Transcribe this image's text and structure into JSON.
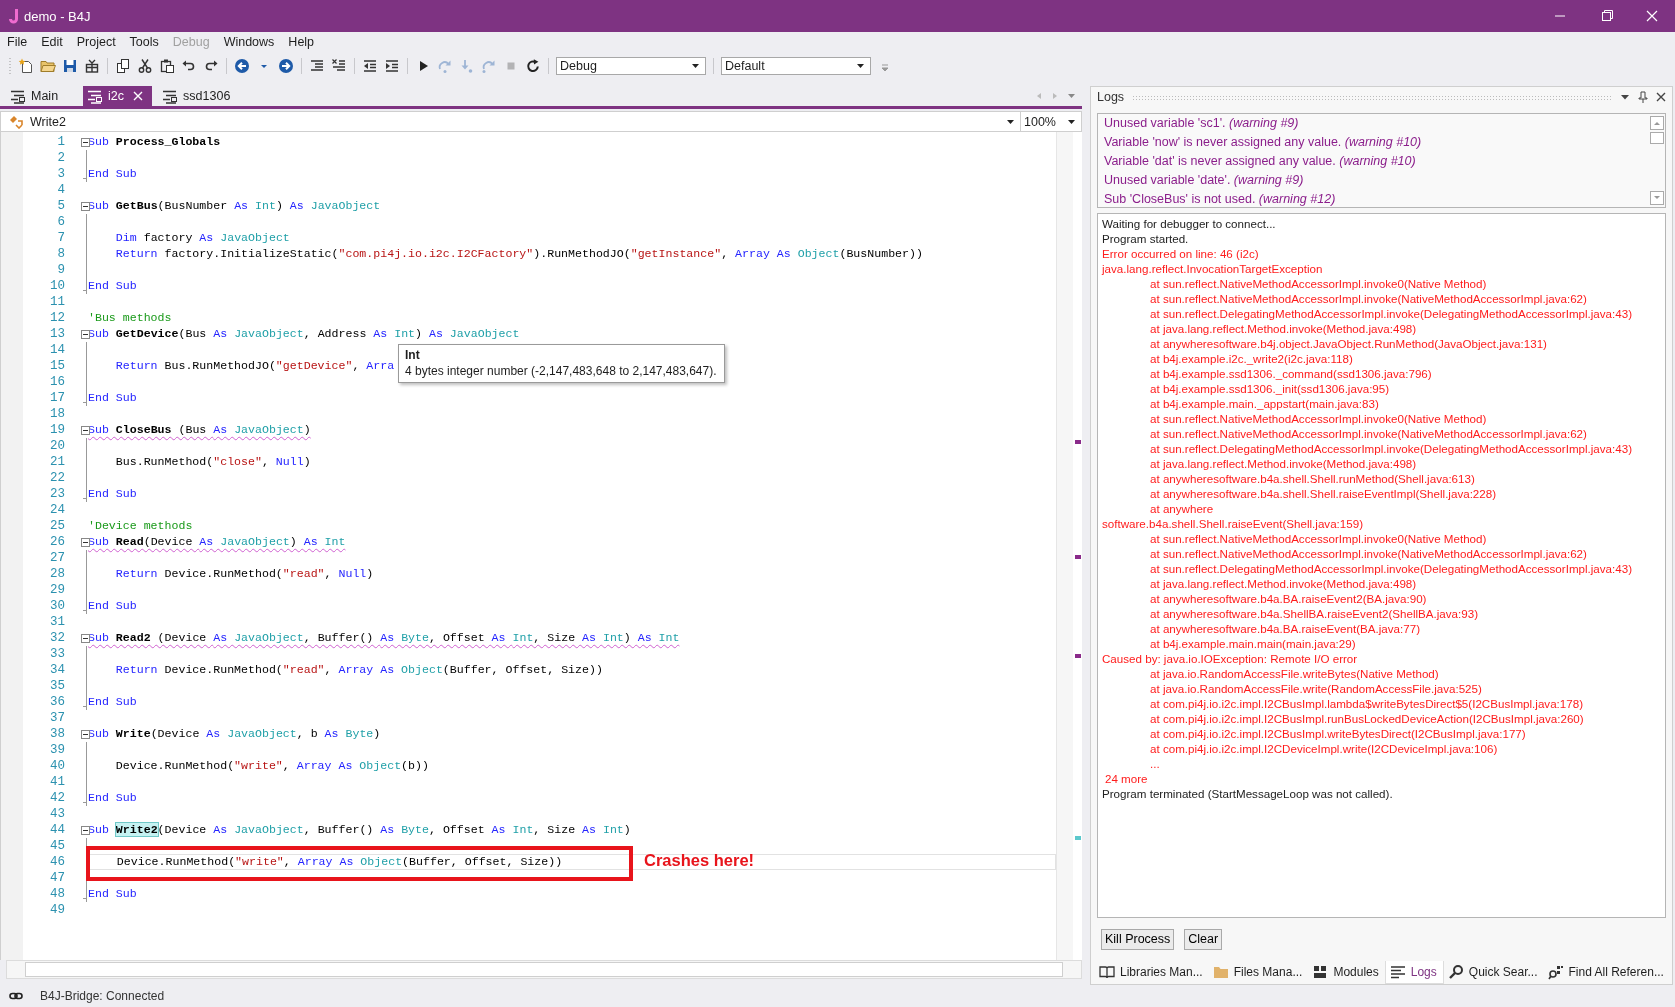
{
  "window": {
    "title": "demo - B4J"
  },
  "menu": [
    {
      "label": "File",
      "disabled": false
    },
    {
      "label": "Edit",
      "disabled": false
    },
    {
      "label": "Project",
      "disabled": false
    },
    {
      "label": "Tools",
      "disabled": false
    },
    {
      "label": "Debug",
      "disabled": true
    },
    {
      "label": "Windows",
      "disabled": false
    },
    {
      "label": "Help",
      "disabled": false
    }
  ],
  "toolbar": {
    "buttons": [
      {
        "kind": "new",
        "disabled": false
      },
      {
        "kind": "open",
        "disabled": false
      },
      {
        "kind": "save",
        "disabled": false
      },
      {
        "kind": "package",
        "disabled": false
      },
      {
        "kind": "separator"
      },
      {
        "kind": "copy",
        "disabled": false
      },
      {
        "kind": "cut",
        "disabled": false
      },
      {
        "kind": "paste",
        "disabled": false
      },
      {
        "kind": "undo",
        "disabled": false
      },
      {
        "kind": "redo",
        "disabled": false
      },
      {
        "kind": "separator"
      },
      {
        "kind": "back",
        "disabled": false
      },
      {
        "kind": "history",
        "disabled": false
      },
      {
        "kind": "forward",
        "disabled": false
      },
      {
        "kind": "separator"
      },
      {
        "kind": "comment",
        "disabled": false
      },
      {
        "kind": "uncomment",
        "disabled": false
      },
      {
        "kind": "separator"
      },
      {
        "kind": "outdent",
        "disabled": false
      },
      {
        "kind": "indent",
        "disabled": false
      },
      {
        "kind": "separator"
      },
      {
        "kind": "run",
        "disabled": false
      },
      {
        "kind": "step_over",
        "disabled": true
      },
      {
        "kind": "step_in",
        "disabled": true
      },
      {
        "kind": "step_out",
        "disabled": true
      },
      {
        "kind": "stop",
        "disabled": true
      },
      {
        "kind": "restart",
        "disabled": false
      }
    ],
    "build_config": "Debug",
    "platform": "Default"
  },
  "editor": {
    "tabs": [
      {
        "label": "Main",
        "selected": false,
        "closable": false
      },
      {
        "label": "i2c",
        "selected": true,
        "closable": true
      },
      {
        "label": "ssd1306",
        "selected": false,
        "closable": false
      }
    ],
    "method": "Write2",
    "zoom": "100%",
    "lines": [
      {
        "number": "1",
        "kind": "sub",
        "warning": false,
        "current": false,
        "tokens": [
          {
            "kind": "keyword",
            "text": "Sub "
          },
          {
            "kind": "name",
            "text": "Process_Globals"
          }
        ]
      },
      {
        "number": "2",
        "kind": "plain",
        "warning": false,
        "current": false
      },
      {
        "number": "3",
        "kind": "end",
        "warning": false,
        "current": false,
        "tokens": [
          {
            "kind": "keyword",
            "text": "End Sub"
          }
        ]
      },
      {
        "number": "4",
        "kind": "plain",
        "warning": false,
        "current": false
      },
      {
        "number": "5",
        "kind": "sub",
        "warning": false,
        "current": false,
        "tokens": [
          {
            "kind": "keyword",
            "text": "Sub "
          },
          {
            "kind": "name",
            "text": "GetBus"
          },
          {
            "kind": "plain",
            "text": "(BusNumber "
          },
          {
            "kind": "keyword",
            "text": "As "
          },
          {
            "kind": "type",
            "text": "Int"
          },
          {
            "kind": "plain",
            "text": ") "
          },
          {
            "kind": "keyword",
            "text": "As "
          },
          {
            "kind": "type",
            "text": "JavaObject"
          }
        ]
      },
      {
        "number": "6",
        "kind": "plain",
        "warning": false,
        "current": false
      },
      {
        "number": "7",
        "kind": "plain",
        "warning": false,
        "current": false,
        "tokens": [
          {
            "kind": "keyword",
            "text": "    Dim "
          },
          {
            "kind": "plain",
            "text": "factory "
          },
          {
            "kind": "keyword",
            "text": "As "
          },
          {
            "kind": "type",
            "text": "JavaObject"
          }
        ]
      },
      {
        "number": "8",
        "kind": "plain",
        "warning": false,
        "current": false,
        "tokens": [
          {
            "kind": "keyword",
            "text": "    Return "
          },
          {
            "kind": "plain",
            "text": "factory.InitializeStatic("
          },
          {
            "kind": "string",
            "text": "\"com.pi4j.io.i2c.I2CFactory\""
          },
          {
            "kind": "plain",
            "text": ").RunMethodJO("
          },
          {
            "kind": "string",
            "text": "\"getInstance\""
          },
          {
            "kind": "plain",
            "text": ", "
          },
          {
            "kind": "keyword",
            "text": "Array As "
          },
          {
            "kind": "type",
            "text": "Object"
          },
          {
            "kind": "plain",
            "text": "(BusNumber))"
          }
        ]
      },
      {
        "number": "9",
        "kind": "plain",
        "warning": false,
        "current": false
      },
      {
        "number": "10",
        "kind": "end",
        "warning": false,
        "current": false,
        "tokens": [
          {
            "kind": "keyword",
            "text": "End Sub"
          }
        ]
      },
      {
        "number": "11",
        "kind": "plain",
        "warning": false,
        "current": false
      },
      {
        "number": "12",
        "kind": "plain",
        "warning": false,
        "current": false,
        "tokens": [
          {
            "kind": "comment",
            "text": "'Bus methods"
          }
        ]
      },
      {
        "number": "13",
        "kind": "sub",
        "warning": false,
        "current": false,
        "tokens": [
          {
            "kind": "keyword",
            "text": "Sub "
          },
          {
            "kind": "name",
            "text": "GetDevice"
          },
          {
            "kind": "plain",
            "text": "(Bus "
          },
          {
            "kind": "keyword",
            "text": "As "
          },
          {
            "kind": "type",
            "text": "JavaObject"
          },
          {
            "kind": "plain",
            "text": ", Address "
          },
          {
            "kind": "keyword",
            "text": "As "
          },
          {
            "kind": "type",
            "text": "Int"
          },
          {
            "kind": "plain",
            "text": ") "
          },
          {
            "kind": "keyword",
            "text": "As "
          },
          {
            "kind": "type",
            "text": "JavaObject"
          }
        ]
      },
      {
        "number": "14",
        "kind": "plain",
        "warning": false,
        "current": false
      },
      {
        "number": "15",
        "kind": "plain",
        "warning": false,
        "current": false,
        "tokens": [
          {
            "kind": "keyword",
            "text": "    Return "
          },
          {
            "kind": "plain",
            "text": "Bus.RunMethodJO("
          },
          {
            "kind": "string",
            "text": "\"getDevice\""
          },
          {
            "kind": "plain",
            "text": ", "
          },
          {
            "kind": "keyword",
            "text": "Arra"
          }
        ]
      },
      {
        "number": "16",
        "kind": "plain",
        "warning": false,
        "current": false
      },
      {
        "number": "17",
        "kind": "end",
        "warning": false,
        "current": false,
        "tokens": [
          {
            "kind": "keyword",
            "text": "End Sub"
          }
        ]
      },
      {
        "number": "18",
        "kind": "plain",
        "warning": false,
        "current": false
      },
      {
        "number": "19",
        "kind": "sub",
        "warning": true,
        "current": false,
        "tokens": [
          {
            "kind": "keyword",
            "text": "Sub "
          },
          {
            "kind": "name",
            "text": "CloseBus"
          },
          {
            "kind": "plain",
            "text": " (Bus "
          },
          {
            "kind": "keyword",
            "text": "As "
          },
          {
            "kind": "type",
            "text": "JavaObject"
          },
          {
            "kind": "plain",
            "text": ")"
          }
        ]
      },
      {
        "number": "20",
        "kind": "plain",
        "warning": false,
        "current": false
      },
      {
        "number": "21",
        "kind": "plain",
        "warning": false,
        "current": false,
        "tokens": [
          {
            "kind": "plain",
            "text": "    Bus.RunMethod("
          },
          {
            "kind": "string",
            "text": "\"close\""
          },
          {
            "kind": "plain",
            "text": ", "
          },
          {
            "kind": "keyword",
            "text": "Null"
          },
          {
            "kind": "plain",
            "text": ")"
          }
        ]
      },
      {
        "number": "22",
        "kind": "plain",
        "warning": false,
        "current": false
      },
      {
        "number": "23",
        "kind": "end",
        "warning": false,
        "current": false,
        "tokens": [
          {
            "kind": "keyword",
            "text": "End Sub"
          }
        ]
      },
      {
        "number": "24",
        "kind": "plain",
        "warning": false,
        "current": false
      },
      {
        "number": "25",
        "kind": "plain",
        "warning": false,
        "current": false,
        "tokens": [
          {
            "kind": "comment",
            "text": "'Device methods"
          }
        ]
      },
      {
        "number": "26",
        "kind": "sub",
        "warning": true,
        "current": false,
        "tokens": [
          {
            "kind": "keyword",
            "text": "Sub "
          },
          {
            "kind": "name",
            "text": "Read"
          },
          {
            "kind": "plain",
            "text": "(Device "
          },
          {
            "kind": "keyword",
            "text": "As "
          },
          {
            "kind": "type",
            "text": "JavaObject"
          },
          {
            "kind": "plain",
            "text": ") "
          },
          {
            "kind": "keyword",
            "text": "As "
          },
          {
            "kind": "type",
            "text": "Int"
          }
        ]
      },
      {
        "number": "27",
        "kind": "plain",
        "warning": false,
        "current": false
      },
      {
        "number": "28",
        "kind": "plain",
        "warning": false,
        "current": false,
        "tokens": [
          {
            "kind": "keyword",
            "text": "    Return "
          },
          {
            "kind": "plain",
            "text": "Device.RunMethod("
          },
          {
            "kind": "string",
            "text": "\"read\""
          },
          {
            "kind": "plain",
            "text": ", "
          },
          {
            "kind": "keyword",
            "text": "Null"
          },
          {
            "kind": "plain",
            "text": ")"
          }
        ]
      },
      {
        "number": "29",
        "kind": "plain",
        "warning": false,
        "current": false
      },
      {
        "number": "30",
        "kind": "end",
        "warning": false,
        "current": false,
        "tokens": [
          {
            "kind": "keyword",
            "text": "End Sub"
          }
        ]
      },
      {
        "number": "31",
        "kind": "plain",
        "warning": false,
        "current": false
      },
      {
        "number": "32",
        "kind": "sub",
        "warning": true,
        "current": false,
        "tokens": [
          {
            "kind": "keyword",
            "text": "Sub "
          },
          {
            "kind": "name",
            "text": "Read2"
          },
          {
            "kind": "plain",
            "text": " (Device "
          },
          {
            "kind": "keyword",
            "text": "As "
          },
          {
            "kind": "type",
            "text": "JavaObject"
          },
          {
            "kind": "plain",
            "text": ", Buffer() "
          },
          {
            "kind": "keyword",
            "text": "As "
          },
          {
            "kind": "type",
            "text": "Byte"
          },
          {
            "kind": "plain",
            "text": ", Offset "
          },
          {
            "kind": "keyword",
            "text": "As "
          },
          {
            "kind": "type",
            "text": "Int"
          },
          {
            "kind": "plain",
            "text": ", Size "
          },
          {
            "kind": "keyword",
            "text": "As "
          },
          {
            "kind": "type",
            "text": "Int"
          },
          {
            "kind": "plain",
            "text": ") "
          },
          {
            "kind": "keyword",
            "text": "As "
          },
          {
            "kind": "type",
            "text": "Int"
          }
        ]
      },
      {
        "number": "33",
        "kind": "plain",
        "warning": false,
        "current": false
      },
      {
        "number": "34",
        "kind": "plain",
        "warning": false,
        "current": false,
        "tokens": [
          {
            "kind": "keyword",
            "text": "    Return "
          },
          {
            "kind": "plain",
            "text": "Device.RunMethod("
          },
          {
            "kind": "string",
            "text": "\"read\""
          },
          {
            "kind": "plain",
            "text": ", "
          },
          {
            "kind": "keyword",
            "text": "Array As "
          },
          {
            "kind": "type",
            "text": "Object"
          },
          {
            "kind": "plain",
            "text": "(Buffer, Offset, Size))"
          }
        ]
      },
      {
        "number": "35",
        "kind": "plain",
        "warning": false,
        "current": false
      },
      {
        "number": "36",
        "kind": "end",
        "warning": false,
        "current": false,
        "tokens": [
          {
            "kind": "keyword",
            "text": "End Sub"
          }
        ]
      },
      {
        "number": "37",
        "kind": "plain",
        "warning": false,
        "current": false
      },
      {
        "number": "38",
        "kind": "sub",
        "warning": false,
        "current": false,
        "tokens": [
          {
            "kind": "keyword",
            "text": "Sub "
          },
          {
            "kind": "name",
            "text": "Write"
          },
          {
            "kind": "plain",
            "text": "(Device "
          },
          {
            "kind": "keyword",
            "text": "As "
          },
          {
            "kind": "type",
            "text": "JavaObject"
          },
          {
            "kind": "plain",
            "text": ", b "
          },
          {
            "kind": "keyword",
            "text": "As "
          },
          {
            "kind": "type",
            "text": "Byte"
          },
          {
            "kind": "plain",
            "text": ")"
          }
        ]
      },
      {
        "number": "39",
        "kind": "plain",
        "warning": false,
        "current": false
      },
      {
        "number": "40",
        "kind": "plain",
        "warning": false,
        "current": false,
        "tokens": [
          {
            "kind": "plain",
            "text": "    Device.RunMethod("
          },
          {
            "kind": "string",
            "text": "\"write\""
          },
          {
            "kind": "plain",
            "text": ", "
          },
          {
            "kind": "keyword",
            "text": "Array As "
          },
          {
            "kind": "type",
            "text": "Object"
          },
          {
            "kind": "plain",
            "text": "(b))"
          }
        ]
      },
      {
        "number": "41",
        "kind": "plain",
        "warning": false,
        "current": false
      },
      {
        "number": "42",
        "kind": "end",
        "warning": false,
        "current": false,
        "tokens": [
          {
            "kind": "keyword",
            "text": "End Sub"
          }
        ]
      },
      {
        "number": "43",
        "kind": "plain",
        "warning": false,
        "current": false
      },
      {
        "number": "44",
        "kind": "sub",
        "warning": false,
        "current": false,
        "tokens": [
          {
            "kind": "keyword",
            "text": "Sub "
          },
          {
            "kind": "match",
            "text": "Write2"
          },
          {
            "kind": "plain",
            "text": "(Device "
          },
          {
            "kind": "keyword",
            "text": "As "
          },
          {
            "kind": "type",
            "text": "JavaObject"
          },
          {
            "kind": "plain",
            "text": ", Buffer() "
          },
          {
            "kind": "keyword",
            "text": "As "
          },
          {
            "kind": "type",
            "text": "Byte"
          },
          {
            "kind": "plain",
            "text": ", Offset "
          },
          {
            "kind": "keyword",
            "text": "As "
          },
          {
            "kind": "type",
            "text": "Int"
          },
          {
            "kind": "plain",
            "text": ", Size "
          },
          {
            "kind": "keyword",
            "text": "As "
          },
          {
            "kind": "type",
            "text": "Int"
          },
          {
            "kind": "plain",
            "text": ")"
          }
        ]
      },
      {
        "number": "45",
        "kind": "plain",
        "warning": false,
        "current": false
      },
      {
        "number": "46",
        "kind": "plain",
        "warning": false,
        "current": true,
        "tokens": [
          {
            "kind": "plain",
            "text": "    Device.RunMethod("
          },
          {
            "kind": "string",
            "text": "\"write\""
          },
          {
            "kind": "plain",
            "text": ", "
          },
          {
            "kind": "keyword",
            "text": "Array As "
          },
          {
            "kind": "type",
            "text": "Object"
          },
          {
            "kind": "plain",
            "text": "(Buffer, Offset, Size))"
          }
        ]
      },
      {
        "number": "47",
        "kind": "plain",
        "warning": false,
        "current": false
      },
      {
        "number": "48",
        "kind": "end",
        "warning": false,
        "current": false,
        "tokens": [
          {
            "kind": "keyword",
            "text": "End Sub"
          }
        ]
      },
      {
        "number": "49",
        "kind": "plain",
        "warning": false,
        "current": false
      }
    ],
    "tooltip": {
      "title": "Int",
      "text": "4 bytes integer number (-2,147,483,648 to 2,147,483,647)."
    },
    "annotation": "Crashes here!"
  },
  "logs": {
    "title": "Logs",
    "warnings": [
      "Unused variable 'sc1'. *(warning #9)*",
      "Variable 'now' is never assigned any value. *(warning #10)*",
      "Variable 'dat' is never assigned any value. *(warning #10)*",
      "Unused variable 'date'. *(warning #9)*",
      "Sub 'CloseBus' is not used. *(warning #12)*"
    ],
    "output": [
      {
        "kind": "info",
        "text": "Waiting for debugger to connect..."
      },
      {
        "kind": "info",
        "text": "Program started."
      },
      {
        "kind": "error",
        "text": "Error occurred on line: 46 (i2c)"
      },
      {
        "kind": "error",
        "text": "java.lang.reflect.InvocationTargetException"
      },
      {
        "kind": "trace",
        "text": "at sun.reflect.NativeMethodAccessorImpl.invoke0(Native Method)"
      },
      {
        "kind": "trace",
        "text": "at sun.reflect.NativeMethodAccessorImpl.invoke(NativeMethodAccessorImpl.java:62)"
      },
      {
        "kind": "trace",
        "text": "at sun.reflect.DelegatingMethodAccessorImpl.invoke(DelegatingMethodAccessorImpl.java:43)"
      },
      {
        "kind": "trace",
        "text": "at java.lang.reflect.Method.invoke(Method.java:498)"
      },
      {
        "kind": "trace",
        "text": "at anywheresoftware.b4j.object.JavaObject.RunMethod(JavaObject.java:131)"
      },
      {
        "kind": "trace",
        "text": "at b4j.example.i2c._write2(i2c.java:118)"
      },
      {
        "kind": "trace",
        "text": "at b4j.example.ssd1306._command(ssd1306.java:796)"
      },
      {
        "kind": "trace",
        "text": "at b4j.example.ssd1306._init(ssd1306.java:95)"
      },
      {
        "kind": "trace",
        "text": "at b4j.example.main._appstart(main.java:83)"
      },
      {
        "kind": "trace",
        "text": "at sun.reflect.NativeMethodAccessorImpl.invoke0(Native Method)"
      },
      {
        "kind": "trace",
        "text": "at sun.reflect.NativeMethodAccessorImpl.invoke(NativeMethodAccessorImpl.java:62)"
      },
      {
        "kind": "trace",
        "text": "at sun.reflect.DelegatingMethodAccessorImpl.invoke(DelegatingMethodAccessorImpl.java:43)"
      },
      {
        "kind": "trace",
        "text": "at java.lang.reflect.Method.invoke(Method.java:498)"
      },
      {
        "kind": "trace",
        "text": "at anywheresoftware.b4a.shell.Shell.runMethod(Shell.java:613)"
      },
      {
        "kind": "trace",
        "text": "at anywheresoftware.b4a.shell.Shell.raiseEventImpl(Shell.java:228)"
      },
      {
        "kind": "trace",
        "text": "at anywhere"
      },
      {
        "kind": "error",
        "text": "software.b4a.shell.Shell.raiseEvent(Shell.java:159)"
      },
      {
        "kind": "trace",
        "text": "at sun.reflect.NativeMethodAccessorImpl.invoke0(Native Method)"
      },
      {
        "kind": "trace",
        "text": "at sun.reflect.NativeMethodAccessorImpl.invoke(NativeMethodAccessorImpl.java:62)"
      },
      {
        "kind": "trace",
        "text": "at sun.reflect.DelegatingMethodAccessorImpl.invoke(DelegatingMethodAccessorImpl.java:43)"
      },
      {
        "kind": "trace",
        "text": "at java.lang.reflect.Method.invoke(Method.java:498)"
      },
      {
        "kind": "trace",
        "text": "at anywheresoftware.b4a.BA.raiseEvent2(BA.java:90)"
      },
      {
        "kind": "trace",
        "text": "at anywheresoftware.b4a.ShellBA.raiseEvent2(ShellBA.java:93)"
      },
      {
        "kind": "trace",
        "text": "at anywheresoftware.b4a.BA.raiseEvent(BA.java:77)"
      },
      {
        "kind": "trace",
        "text": "at b4j.example.main.main(main.java:29)"
      },
      {
        "kind": "error",
        "text": "Caused by: java.io.IOException: Remote I/O error"
      },
      {
        "kind": "trace",
        "text": "at java.io.RandomAccessFile.writeBytes(Native Method)"
      },
      {
        "kind": "trace",
        "text": "at java.io.RandomAccessFile.write(RandomAccessFile.java:525)"
      },
      {
        "kind": "trace",
        "text": "at com.pi4j.io.i2c.impl.I2CBusImpl.lambda$writeBytesDirect$5(I2CBusImpl.java:178)"
      },
      {
        "kind": "trace",
        "text": "at com.pi4j.io.i2c.impl.I2CBusImpl.runBusLockedDeviceAction(I2CBusImpl.java:260)"
      },
      {
        "kind": "trace",
        "text": "at com.pi4j.io.i2c.impl.I2CBusImpl.writeBytesDirect(I2CBusImpl.java:177)"
      },
      {
        "kind": "trace",
        "text": "at com.pi4j.io.i2c.impl.I2CDeviceImpl.write(I2CDeviceImpl.java:106)"
      },
      {
        "kind": "trace",
        "text": "..."
      },
      {
        "kind": "more",
        "text": "24 more"
      },
      {
        "kind": "info",
        "text": "Program terminated (StartMessageLoop was not called)."
      }
    ],
    "buttons": [
      "Kill Process",
      "Clear"
    ]
  },
  "dock_tabs": [
    {
      "kind": "libraries",
      "label": "Libraries Man...",
      "selected": false
    },
    {
      "kind": "files",
      "label": "Files Mana...",
      "selected": false
    },
    {
      "kind": "modules",
      "label": "Modules",
      "selected": false
    },
    {
      "kind": "logs",
      "label": "Logs",
      "selected": true
    },
    {
      "kind": "search",
      "label": "Quick Sear...",
      "selected": false
    },
    {
      "kind": "references",
      "label": "Find All Referen...",
      "selected": false
    }
  ],
  "status_bar": {
    "text": "B4J-Bridge: Connected"
  }
}
